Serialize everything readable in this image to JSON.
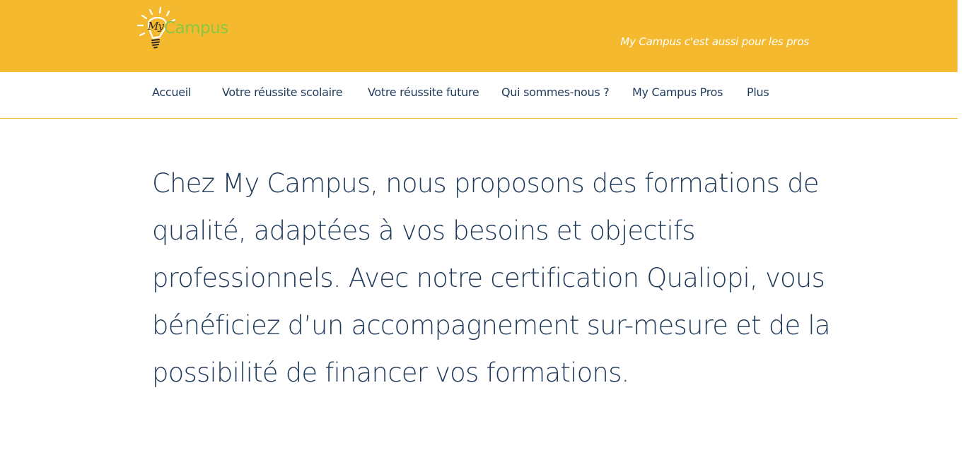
{
  "header": {
    "logo": {
      "my_text": "My",
      "campus_text": "Campus"
    },
    "pro_link": "My Campus c'est aussi pour les pros",
    "colors": {
      "background": "#f5b930",
      "logo_green": "#8cc63f"
    }
  },
  "nav": {
    "items": [
      {
        "label": "Accueil"
      },
      {
        "label": "Votre réussite scolaire"
      },
      {
        "label": "Votre réussite future"
      },
      {
        "label": "Qui sommes-nous ?"
      },
      {
        "label": "My Campus Pros"
      },
      {
        "label": "Plus"
      }
    ]
  },
  "main": {
    "paragraph": "Chez My Campus, nous proposons des formations de qualité, adaptées à vos besoins et objectifs professionnels. Avec notre certification Qualiopi, vous bénéficiez d’un accompagnement sur-mesure et de la possibilité de financer vos formations.",
    "text_color": "#1f3a5a"
  }
}
